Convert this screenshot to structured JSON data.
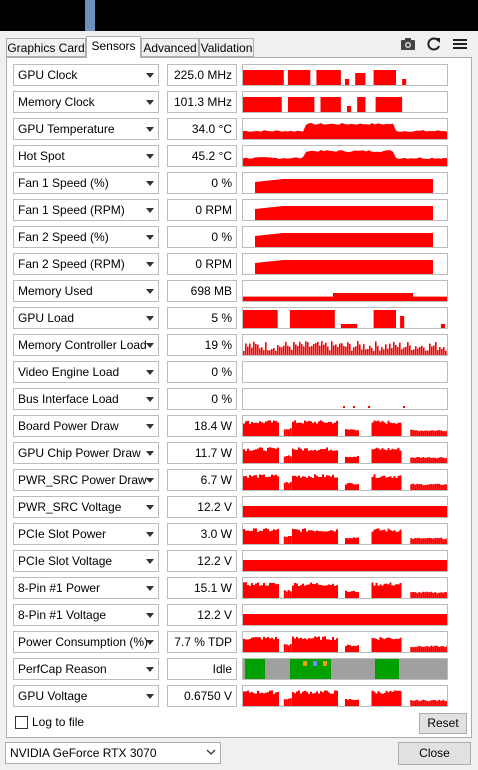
{
  "tabs": [
    "Graphics Card",
    "Sensors",
    "Advanced",
    "Validation"
  ],
  "active_tab": "Sensors",
  "toolbar_icons": [
    "camera-icon",
    "refresh-icon",
    "menu-icon"
  ],
  "sensors": [
    {
      "name": "GPU Clock",
      "value": "225.0 MHz"
    },
    {
      "name": "Memory Clock",
      "value": "101.3 MHz"
    },
    {
      "name": "GPU Temperature",
      "value": "34.0 °C"
    },
    {
      "name": "Hot Spot",
      "value": "45.2 °C"
    },
    {
      "name": "Fan 1 Speed (%)",
      "value": "0 %"
    },
    {
      "name": "Fan 1 Speed (RPM)",
      "value": "0 RPM"
    },
    {
      "name": "Fan 2 Speed (%)",
      "value": "0 %"
    },
    {
      "name": "Fan 2 Speed (RPM)",
      "value": "0 RPM"
    },
    {
      "name": "Memory Used",
      "value": "698 MB"
    },
    {
      "name": "GPU Load",
      "value": "5 %"
    },
    {
      "name": "Memory Controller Load",
      "value": "19 %"
    },
    {
      "name": "Video Engine Load",
      "value": "0 %"
    },
    {
      "name": "Bus Interface Load",
      "value": "0 %"
    },
    {
      "name": "Board Power Draw",
      "value": "18.4 W"
    },
    {
      "name": "GPU Chip Power Draw",
      "value": "11.7 W"
    },
    {
      "name": "PWR_SRC Power Draw",
      "value": "6.7 W"
    },
    {
      "name": "PWR_SRC Voltage",
      "value": "12.2 V"
    },
    {
      "name": "PCIe Slot Power",
      "value": "3.0 W"
    },
    {
      "name": "PCIe Slot Voltage",
      "value": "12.2 V"
    },
    {
      "name": "8-Pin #1 Power",
      "value": "15.1 W"
    },
    {
      "name": "8-Pin #1 Voltage",
      "value": "12.2 V"
    },
    {
      "name": "Power Consumption (%)",
      "value": "7.7 % TDP"
    },
    {
      "name": "PerfCap Reason",
      "value": "Idle"
    },
    {
      "name": "GPU Voltage",
      "value": "0.6750 V"
    }
  ],
  "log_to_file": {
    "label": "Log to file",
    "checked": false
  },
  "reset_label": "Reset",
  "gpu_select": "NVIDIA GeForce RTX 3070",
  "close_label": "Close",
  "colors": {
    "graph": "#ff0000",
    "perfcap_idle": "#00a000",
    "perfcap_bg": "#a0a0a0"
  }
}
